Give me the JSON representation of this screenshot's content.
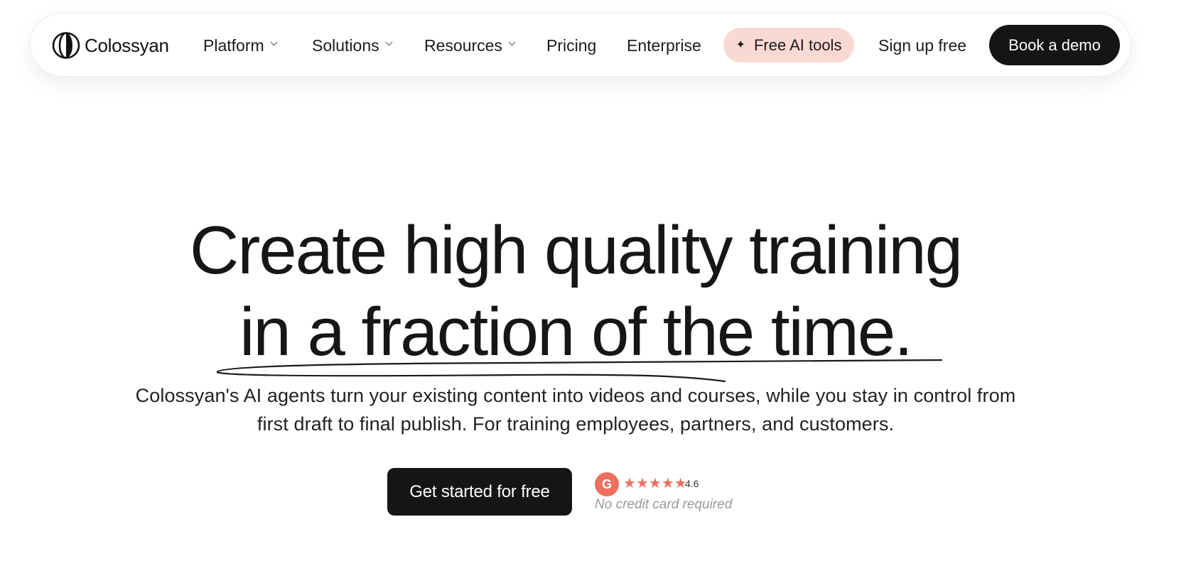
{
  "brand": {
    "name": "Colossyan"
  },
  "nav": {
    "items": [
      {
        "label": "Platform",
        "has_dropdown": true
      },
      {
        "label": "Solutions",
        "has_dropdown": true
      },
      {
        "label": "Resources",
        "has_dropdown": true
      },
      {
        "label": "Pricing",
        "has_dropdown": false
      },
      {
        "label": "Enterprise",
        "has_dropdown": false
      }
    ],
    "free_tools_label": "Free AI tools",
    "free_tools_icon": "sparkle-icon",
    "sign_up_label": "Sign up free",
    "book_demo_label": "Book a demo"
  },
  "hero": {
    "title_line1": "Create high quality training",
    "title_line2": "in a fraction of the time.",
    "subtitle_line1": "Colossyan's AI agents turn your existing content into videos and courses, while you stay in control from",
    "subtitle_line2": "first draft to final publish. For training employees, partners, and customers.",
    "cta_label": "Get started for free",
    "review": {
      "badge_letter": "G",
      "stars": 4.6,
      "rating_text": "4.6"
    },
    "no_credit_card": "No credit card required"
  },
  "colors": {
    "primary_dark": "#151515",
    "free_tools_bg": "#fbd9d3",
    "g2_accent": "#ef6f5f",
    "muted_text": "#9a9a9a"
  }
}
